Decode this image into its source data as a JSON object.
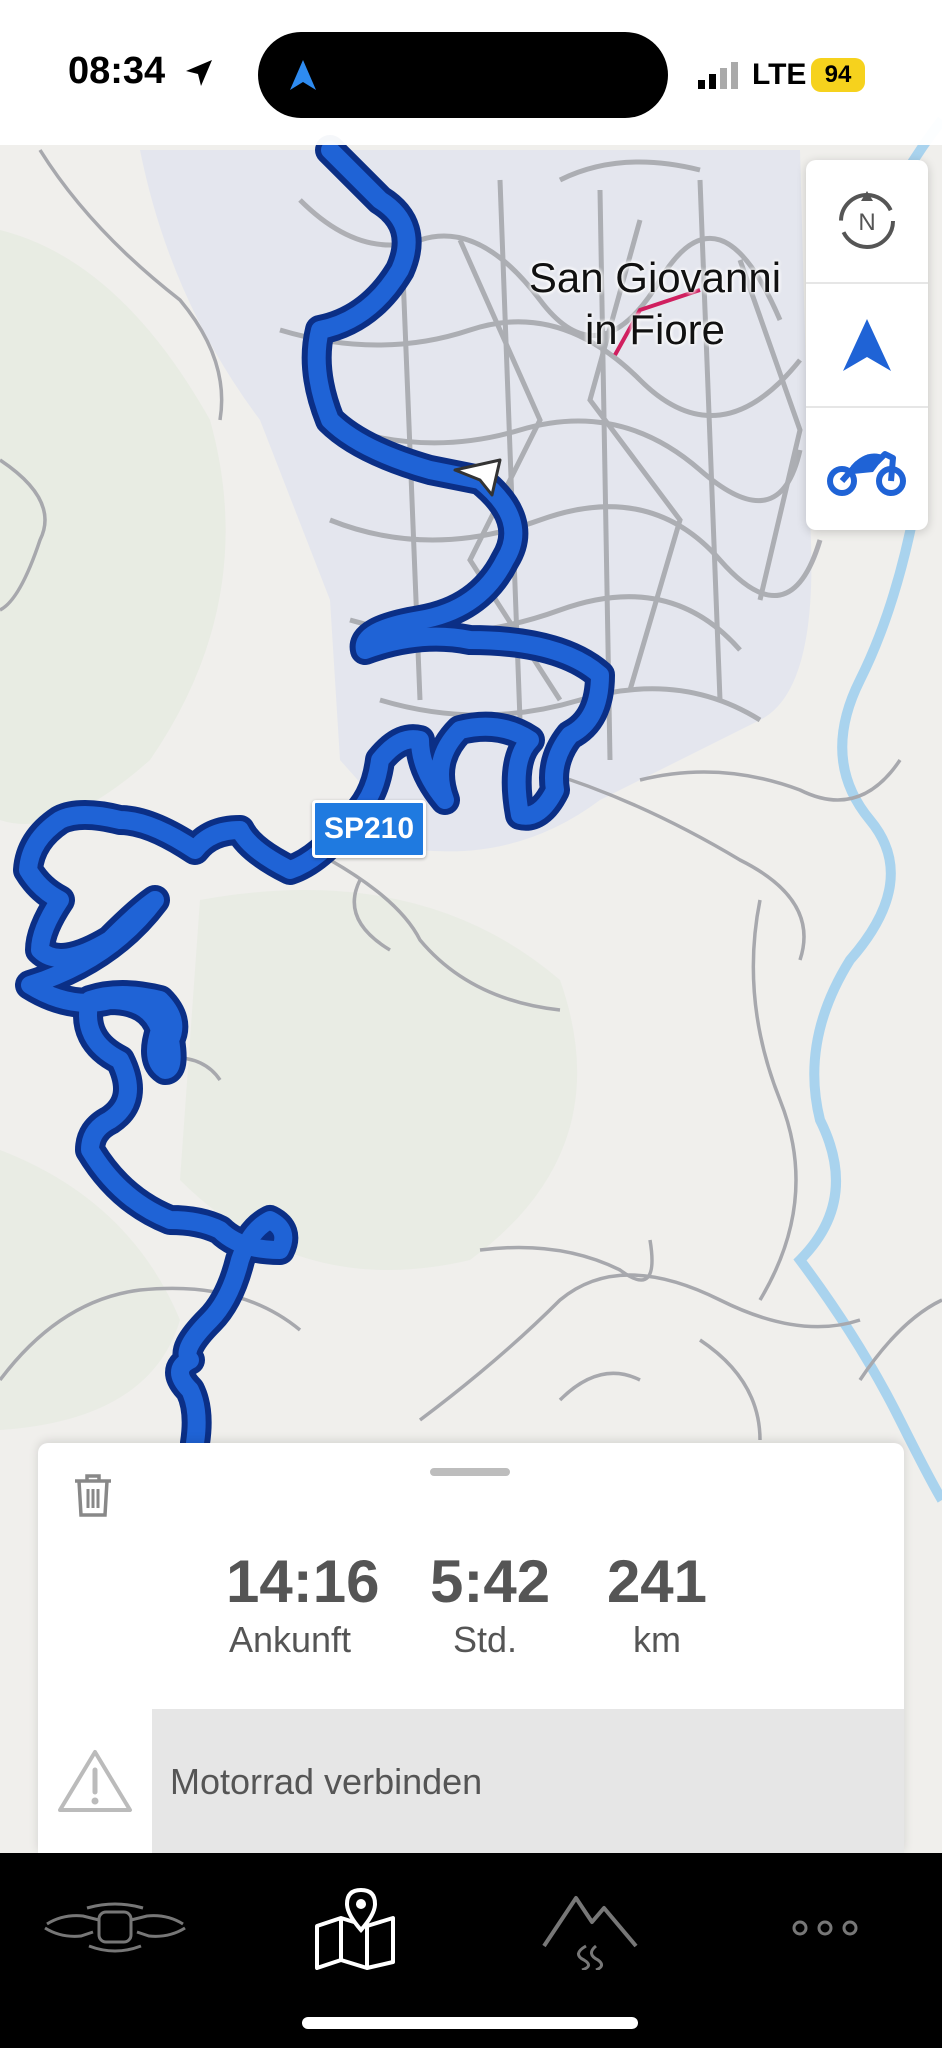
{
  "status_bar": {
    "time": "08:34",
    "network": "LTE",
    "battery": "94"
  },
  "map": {
    "city_label_line1": "San Giovanni",
    "city_label_line2": "in Fiore",
    "road_badge": "SP210",
    "route_color": "#1f63d6",
    "route_outline_color": "#0b2f86"
  },
  "map_controls": [
    {
      "icon": "compass-north-icon"
    },
    {
      "icon": "navigation-arrow-icon"
    },
    {
      "icon": "motorcycle-icon"
    }
  ],
  "route_summary": {
    "arrival": {
      "value": "14:16",
      "label": "Ankunft"
    },
    "duration": {
      "value": "5:42",
      "label": "Std."
    },
    "distance": {
      "value": "241",
      "label": "km"
    }
  },
  "connect_row": {
    "label": "Motorrad verbinden",
    "icon": "warning-triangle-icon"
  },
  "tab_bar": {
    "tabs": [
      {
        "icon": "handlebar-icon"
      },
      {
        "icon": "map-pin-icon",
        "selected": true
      },
      {
        "icon": "mountain-road-icon"
      },
      {
        "icon": "more-dots-icon"
      }
    ]
  }
}
